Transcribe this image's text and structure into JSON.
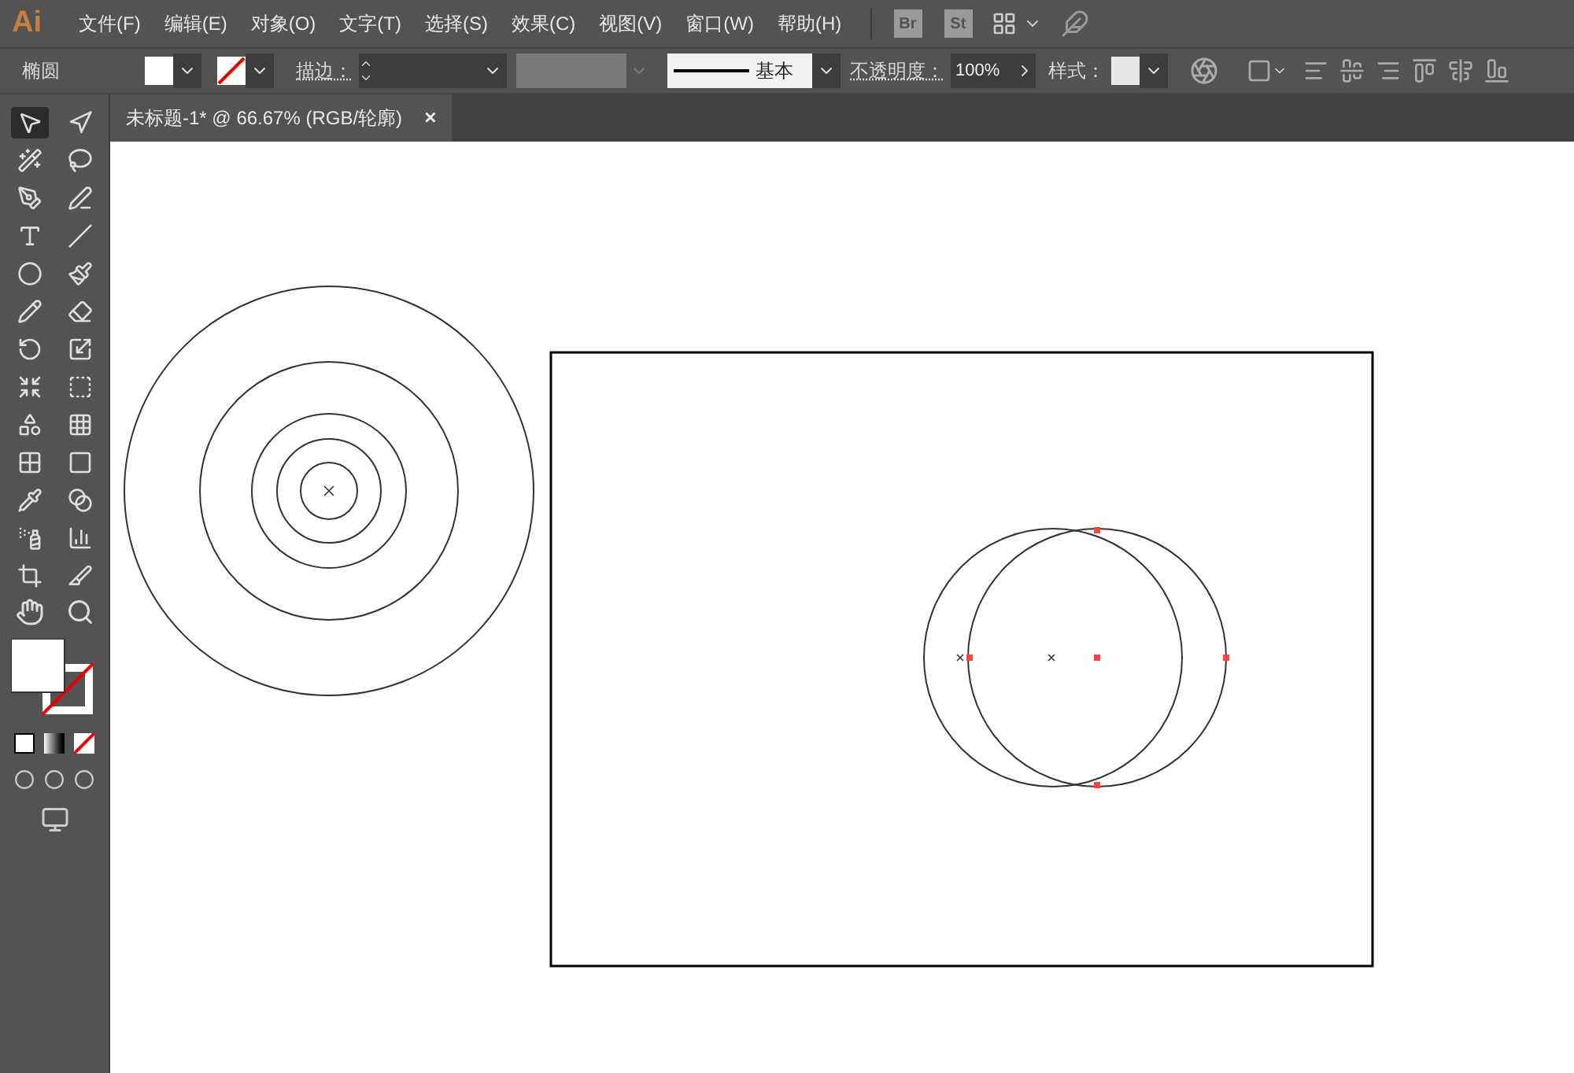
{
  "app": {
    "logo": "Ai"
  },
  "menu": [
    "文件(F)",
    "编辑(E)",
    "对象(O)",
    "文字(T)",
    "选择(S)",
    "效果(C)",
    "视图(V)",
    "窗口(W)",
    "帮助(H)"
  ],
  "app_buttons": [
    "Br",
    "St"
  ],
  "control_bar": {
    "object_type": "椭圆",
    "stroke_label": "描边：",
    "stroke_style": "基本",
    "opacity_label": "不透明度：",
    "opacity_value": "100%",
    "style_label": "样式："
  },
  "document_tab": {
    "title": "未标题-1* @ 66.67% (RGB/轮廓)",
    "close": "×",
    "selected": true
  },
  "tools": [
    {
      "selected": true
    },
    {
      "selected": false
    },
    {
      "selected": false
    },
    {
      "selected": false
    },
    {
      "selected": false
    },
    {
      "selected": false
    },
    {
      "selected": false
    },
    {
      "selected": false
    },
    {
      "selected": false
    },
    {
      "selected": false
    },
    {
      "selected": false
    },
    {
      "selected": false
    },
    {
      "selected": false
    },
    {
      "selected": false
    },
    {
      "selected": false
    },
    {
      "selected": false
    },
    {
      "selected": false
    },
    {
      "selected": false
    },
    {
      "selected": false
    },
    {
      "selected": false
    },
    {
      "selected": false
    },
    {
      "selected": false
    },
    {
      "selected": false
    },
    {
      "selected": false
    },
    {
      "selected": false
    },
    {
      "selected": false
    }
  ]
}
